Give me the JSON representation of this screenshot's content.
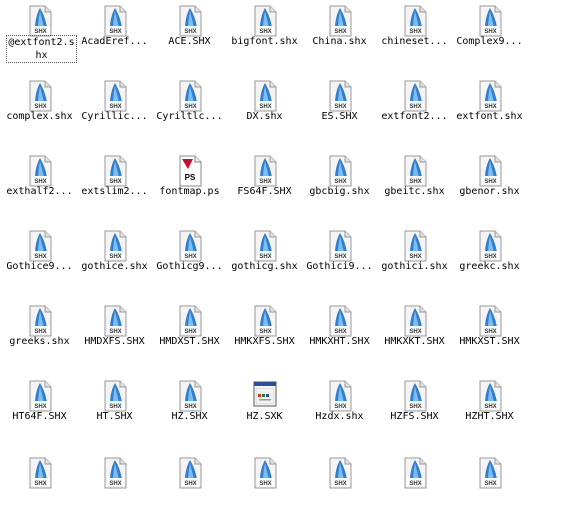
{
  "window": {
    "view": "explorer-icons"
  },
  "files": [
    {
      "name": "@extfont2.shx",
      "icon": "shx-file-icon",
      "selected": true
    },
    {
      "name": "AcadEref...",
      "icon": "shx-file-icon"
    },
    {
      "name": "ACE.SHX",
      "icon": "shx-file-icon"
    },
    {
      "name": "bigfont.shx",
      "icon": "shx-file-icon"
    },
    {
      "name": "China.shx",
      "icon": "shx-file-icon"
    },
    {
      "name": "chineset...",
      "icon": "shx-file-icon"
    },
    {
      "name": "Complex9...",
      "icon": "shx-file-icon"
    },
    {
      "name": "complex.shx",
      "icon": "shx-file-icon"
    },
    {
      "name": "Cyrillic...",
      "icon": "shx-file-icon"
    },
    {
      "name": "Cyriltlc...",
      "icon": "shx-file-icon"
    },
    {
      "name": "DX.shx",
      "icon": "shx-file-icon"
    },
    {
      "name": "ES.SHX",
      "icon": "shx-file-icon"
    },
    {
      "name": "extfont2...",
      "icon": "shx-file-icon"
    },
    {
      "name": "extfont.shx",
      "icon": "shx-file-icon"
    },
    {
      "name": "exthalf2...",
      "icon": "shx-file-icon"
    },
    {
      "name": "extslim2...",
      "icon": "shx-file-icon"
    },
    {
      "name": "fontmap.ps",
      "icon": "ps-file-icon"
    },
    {
      "name": "FS64F.SHX",
      "icon": "shx-file-icon"
    },
    {
      "name": "gbcbig.shx",
      "icon": "shx-file-icon"
    },
    {
      "name": "gbeitc.shx",
      "icon": "shx-file-icon"
    },
    {
      "name": "gbenor.shx",
      "icon": "shx-file-icon"
    },
    {
      "name": "Gothice9...",
      "icon": "shx-file-icon"
    },
    {
      "name": "gothice.shx",
      "icon": "shx-file-icon"
    },
    {
      "name": "Gothicg9...",
      "icon": "shx-file-icon"
    },
    {
      "name": "gothicg.shx",
      "icon": "shx-file-icon"
    },
    {
      "name": "Gothici9...",
      "icon": "shx-file-icon"
    },
    {
      "name": "gothici.shx",
      "icon": "shx-file-icon"
    },
    {
      "name": "greekc.shx",
      "icon": "shx-file-icon"
    },
    {
      "name": "greeks.shx",
      "icon": "shx-file-icon"
    },
    {
      "name": "HMDXFS.SHX",
      "icon": "shx-file-icon"
    },
    {
      "name": "HMDXST.SHX",
      "icon": "shx-file-icon"
    },
    {
      "name": "HMKXFS.SHX",
      "icon": "shx-file-icon"
    },
    {
      "name": "HMKXHT.SHX",
      "icon": "shx-file-icon"
    },
    {
      "name": "HMKXKT.SHX",
      "icon": "shx-file-icon"
    },
    {
      "name": "HMKXST.SHX",
      "icon": "shx-file-icon"
    },
    {
      "name": "HT64F.SHX",
      "icon": "shx-file-icon"
    },
    {
      "name": "HT.SHX",
      "icon": "shx-file-icon"
    },
    {
      "name": "HZ.SHX",
      "icon": "shx-file-icon"
    },
    {
      "name": "HZ.SXK",
      "icon": "sxk-file-icon"
    },
    {
      "name": "Hzdx.shx",
      "icon": "shx-file-icon"
    },
    {
      "name": "HZFS.SHX",
      "icon": "shx-file-icon"
    },
    {
      "name": "HZHT.SHX",
      "icon": "shx-file-icon"
    },
    {
      "name": "",
      "icon": "shx-file-icon"
    },
    {
      "name": "",
      "icon": "shx-file-icon"
    },
    {
      "name": "",
      "icon": "shx-file-icon"
    },
    {
      "name": "",
      "icon": "shx-file-icon"
    },
    {
      "name": "",
      "icon": "shx-file-icon"
    },
    {
      "name": "",
      "icon": "shx-file-icon"
    },
    {
      "name": "",
      "icon": "shx-file-icon"
    }
  ],
  "icon_text": {
    "shx": "SHX",
    "ps": "PS"
  },
  "colors": {
    "shx_blue": "#2f7fd0",
    "ps_red": "#c8102e",
    "page_bg": "#ffffff"
  }
}
